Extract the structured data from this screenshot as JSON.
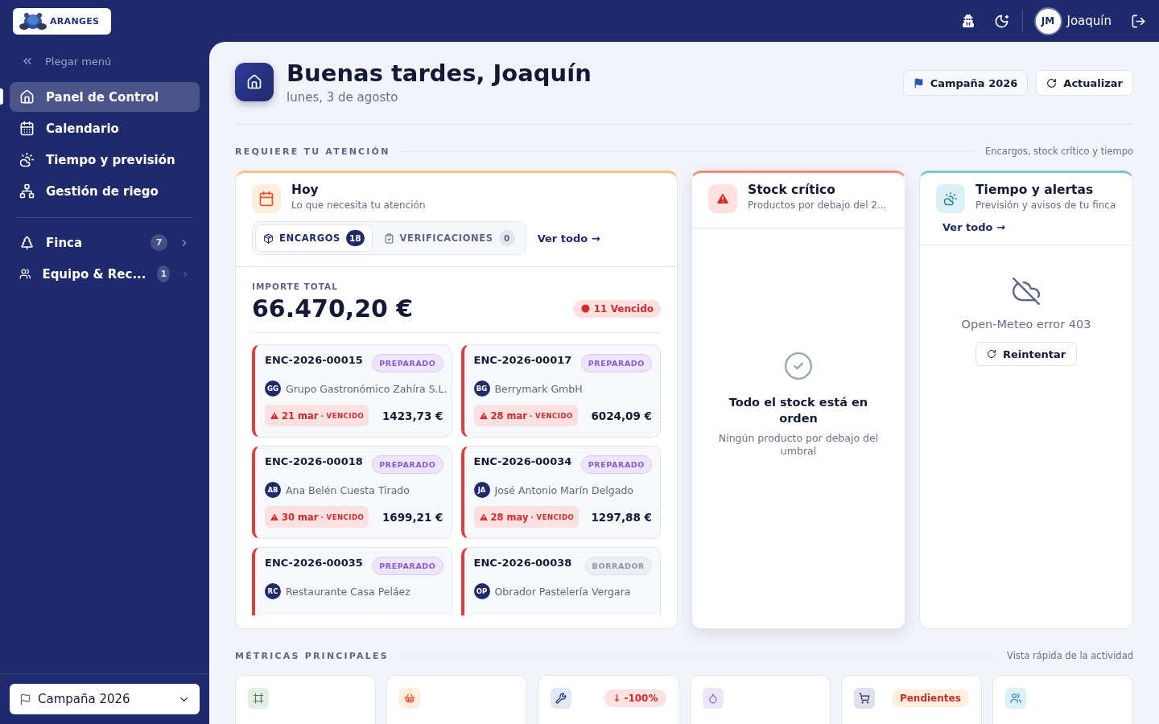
{
  "header": {
    "logo_text": "ARANGES",
    "user": {
      "initials": "JM",
      "name": "Joaquín"
    }
  },
  "sidebar": {
    "collapse": "Plegar menú",
    "groups": [
      [
        {
          "label": "Panel de Control",
          "kind": "home",
          "selected": true
        },
        {
          "label": "Calendario",
          "kind": "calendar",
          "selected": false
        },
        {
          "label": "Tiempo y previsión",
          "kind": "weather",
          "selected": false
        },
        {
          "label": "Gestión de riego",
          "kind": "network",
          "selected": false
        }
      ],
      [
        {
          "label": "Finca",
          "kind": "tree",
          "selected": false,
          "count": "7"
        },
        {
          "label": "Equipo & Rec...",
          "kind": "team",
          "selected": false,
          "count": "1"
        }
      ]
    ],
    "campaign": "Campaña 2026"
  },
  "page": {
    "title": "Buenas tardes, Joaquín",
    "date": "lunes, 3 de agosto",
    "buttons": [
      {
        "label": "Campaña 2026",
        "kind": "campaign"
      },
      {
        "label": "Actualizar",
        "kind": "refresh"
      }
    ]
  },
  "attention": {
    "title": "REQUIERE TU ATENCIÓN",
    "note": "Encargos, stock crítico y tiempo"
  },
  "today": {
    "title": "Hoy",
    "subtitle": "Lo que necesita tu atención",
    "tabs": [
      {
        "label": "ENCARGOS",
        "count": "18",
        "kind": "package",
        "selected": true
      },
      {
        "label": "VERIFICACIONES",
        "count": "0",
        "kind": "clipboard",
        "selected": false
      }
    ],
    "link": "Ver todo →",
    "total_label": "IMPORTE TOTAL",
    "total": "66.470,20 €",
    "overdue": "11 Vencido",
    "orders": [
      {
        "id": "ENC-2026-00015",
        "status": "PREPARADO",
        "kind": "prepared",
        "initials": "GG",
        "customer": "Grupo Gastronómico Zahíra S.L.",
        "due": "21 mar",
        "due_note": "· VENCIDO",
        "amount": "1423,73 €"
      },
      {
        "id": "ENC-2026-00017",
        "status": "PREPARADO",
        "kind": "prepared",
        "initials": "BG",
        "customer": "Berrymark GmbH",
        "due": "28 mar",
        "due_note": "· VENCIDO",
        "amount": "6024,09 €"
      },
      {
        "id": "ENC-2026-00018",
        "status": "PREPARADO",
        "kind": "prepared",
        "initials": "AB",
        "customer": "Ana Belén Cuesta Tirado",
        "due": "30 mar",
        "due_note": "· VENCIDO",
        "amount": "1699,21 €"
      },
      {
        "id": "ENC-2026-00034",
        "status": "PREPARADO",
        "kind": "prepared",
        "initials": "JA",
        "customer": "José Antonio Marín Delgado",
        "due": "28 may",
        "due_note": "· VENCIDO",
        "amount": "1297,88 €"
      },
      {
        "id": "ENC-2026-00035",
        "status": "PREPARADO",
        "kind": "prepared",
        "initials": "RC",
        "customer": "Restaurante Casa Peláez"
      },
      {
        "id": "ENC-2026-00038",
        "status": "BORRADOR",
        "kind": "draft",
        "initials": "OP",
        "customer": "Obrador Pastelería Vergara"
      }
    ]
  },
  "stock": {
    "title": "Stock crítico",
    "subtitle": "Productos por debajo del 2...",
    "empty_title": "Todo el stock está en orden",
    "empty_text": "Ningún producto por debajo del umbral"
  },
  "weather": {
    "title": "Tiempo y alertas",
    "subtitle": "Previsión y avisos de tu finca",
    "link": "Ver todo →",
    "error": "Open-Meteo error 403",
    "retry": "Reintentar"
  },
  "metrics": {
    "title": "MÉTRICAS PRINCIPALES",
    "note": "Vista rápida de la actividad",
    "cards": [
      {
        "kind": "area"
      },
      {
        "kind": "basket"
      },
      {
        "kind": "tools",
        "badge": {
          "text": "↓ -100%",
          "kind": "down"
        }
      },
      {
        "kind": "drop"
      },
      {
        "kind": "cart",
        "badge": {
          "text": "Pendientes",
          "kind": "pending"
        }
      },
      {
        "kind": "team"
      }
    ]
  }
}
